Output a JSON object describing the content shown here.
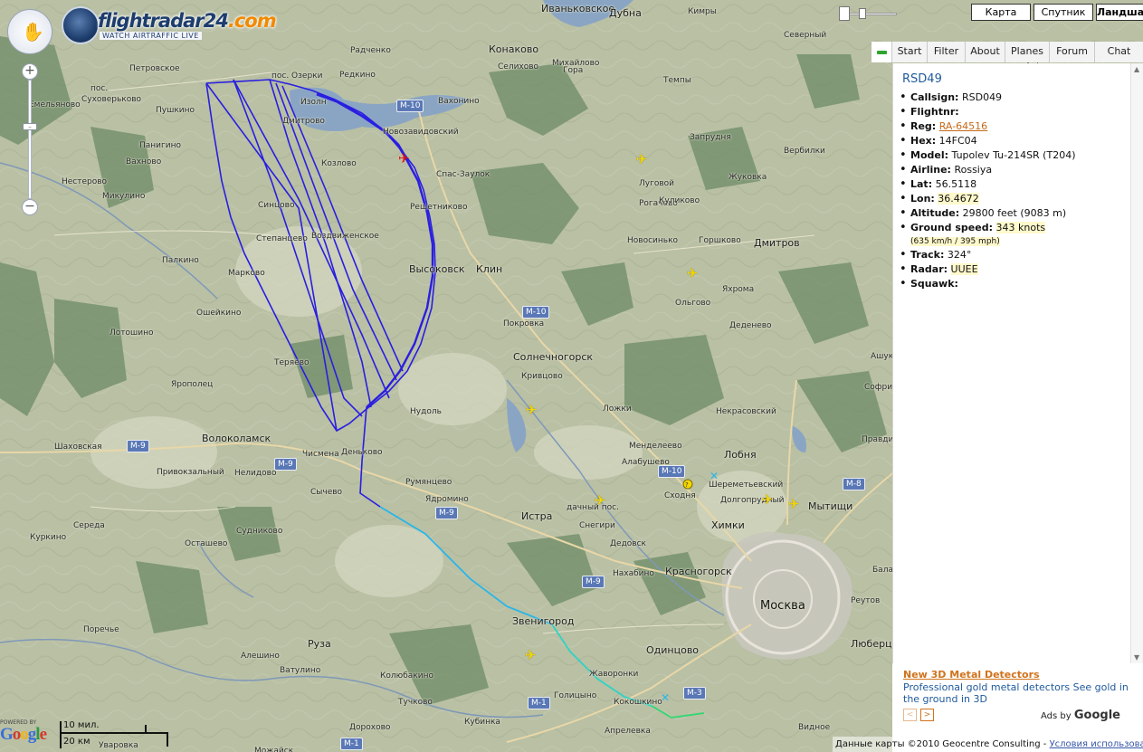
{
  "logo": {
    "name": "flightradar",
    "name_num": "24",
    "name_domain": ".com",
    "tagline": "WATCH AIRTRAFFIC LIVE"
  },
  "zoom": {
    "plus": "+",
    "minus": "−",
    "mid": "–"
  },
  "map_types": [
    "Карта",
    "Спутник",
    "Ландшафт"
  ],
  "tabs": [
    "Start",
    "Filter",
    "About",
    "Planes",
    "Forum",
    "Chat"
  ],
  "flight": {
    "title": "RSD49",
    "fields": [
      {
        "label": "Callsign:",
        "value": "RSD049"
      },
      {
        "label": "Flightnr:",
        "value": ""
      },
      {
        "label": "Reg:",
        "value": "RA-64516"
      },
      {
        "label": "Hex:",
        "value": "14FC04"
      },
      {
        "label": "Model:",
        "value": "Tupolev Tu-214SR (T204)"
      },
      {
        "label": "Airline:",
        "value": "Rossiya"
      },
      {
        "label": "Lat:",
        "value": "56.5118"
      },
      {
        "label": "Lon:",
        "value": "36.4672"
      },
      {
        "label": "Altitude:",
        "value": "29800 feet (9083 m)"
      },
      {
        "label": "Ground speed:",
        "value": "343 knots"
      },
      {
        "label": "",
        "value": "(635 km/h / 395 mph)"
      },
      {
        "label": "Track:",
        "value": "324°"
      },
      {
        "label": "Radar:",
        "value": "UUEE"
      },
      {
        "label": "Squawk:",
        "value": ""
      }
    ]
  },
  "ad": {
    "title": "New 3D Metal Detectors",
    "text": "Professional gold metal detectors See gold in the ground in 3D",
    "prev": "<",
    "next": ">",
    "ads_by": "Ads by ",
    "ads_brand": "Google"
  },
  "footer": {
    "powered": "POWERED BY",
    "google": "Google",
    "scale_mi": "10 мил.",
    "scale_km": "20 км",
    "copyright": "Данные карты ©2010 Geocentre Consulting - ",
    "terms": "Условия использования"
  },
  "places": [
    {
      "t": "Иваньковское",
      "c": "big"
    },
    {
      "t": "Дубна",
      "c": "big"
    },
    {
      "t": "Кимры"
    },
    {
      "t": "Кубринск"
    },
    {
      "t": "Конаково",
      "c": "big"
    },
    {
      "t": "Радченко"
    },
    {
      "t": "Михайлово"
    },
    {
      "t": "Гора"
    },
    {
      "t": "Селихово"
    },
    {
      "t": "Темпы"
    },
    {
      "t": "Северный"
    },
    {
      "t": "Петровское"
    },
    {
      "t": "пос."
    },
    {
      "t": "Суховерьково"
    },
    {
      "t": "Пушкино"
    },
    {
      "t": "Емельяново"
    },
    {
      "t": "пос. Озерки"
    },
    {
      "t": "Редкино"
    },
    {
      "t": "Изолн"
    },
    {
      "t": "Вахонино"
    },
    {
      "t": "Запрудня"
    },
    {
      "t": "Вербилки"
    },
    {
      "t": "Дмитрово"
    },
    {
      "t": "Новозавидовский"
    },
    {
      "t": "Панигино"
    },
    {
      "t": "Вахново"
    },
    {
      "t": "Козлово"
    },
    {
      "t": "Спас-Заулок"
    },
    {
      "t": "Луговой"
    },
    {
      "t": "Жуковка"
    },
    {
      "t": "Нестерово"
    },
    {
      "t": "Микулино"
    },
    {
      "t": "Синцово"
    },
    {
      "t": "Решетниково"
    },
    {
      "t": "Рогачево"
    },
    {
      "t": "Куликово"
    },
    {
      "t": "Степанцево"
    },
    {
      "t": "Воздвиженское"
    },
    {
      "t": "Новосинько"
    },
    {
      "t": "Горшково"
    },
    {
      "t": "Дмитров",
      "c": "big"
    },
    {
      "t": "Палкино"
    },
    {
      "t": "Марково"
    },
    {
      "t": "Высоковск",
      "c": "big"
    },
    {
      "t": "Клин",
      "c": "big"
    },
    {
      "t": "Ольгово"
    },
    {
      "t": "Яхрома"
    },
    {
      "t": "Ошейкино"
    },
    {
      "t": "Покровка"
    },
    {
      "t": "Деденево"
    },
    {
      "t": "Лотошино"
    },
    {
      "t": "Теряево"
    },
    {
      "t": "Солнечногорск",
      "c": "big"
    },
    {
      "t": "Ашукино"
    },
    {
      "t": "Ярополец"
    },
    {
      "t": "Кривцово"
    },
    {
      "t": "Софрино"
    },
    {
      "t": "Нудоль"
    },
    {
      "t": "Ложки"
    },
    {
      "t": "Некрасовский"
    },
    {
      "t": "Волоколамск",
      "c": "big"
    },
    {
      "t": "Шаховская"
    },
    {
      "t": "Чисмена"
    },
    {
      "t": "Деньково"
    },
    {
      "t": "Менделеево"
    },
    {
      "t": "Лобня",
      "c": "big"
    },
    {
      "t": "Правдинский"
    },
    {
      "t": "Алабушево"
    },
    {
      "t": "Шереметьевский"
    },
    {
      "t": "Привокзальный"
    },
    {
      "t": "Нелидово"
    },
    {
      "t": "Румянцево"
    },
    {
      "t": "Сычево"
    },
    {
      "t": "Сходня"
    },
    {
      "t": "Долгопрудный"
    },
    {
      "t": "Мытищи",
      "c": "big"
    },
    {
      "t": "Ядромино"
    },
    {
      "t": "Истра",
      "c": "big"
    },
    {
      "t": "Химки",
      "c": "big"
    },
    {
      "t": "Середа"
    },
    {
      "t": "Снегири"
    },
    {
      "t": "Дедовск"
    },
    {
      "t": "Куркино"
    },
    {
      "t": "Судниково"
    },
    {
      "t": "Осташево"
    },
    {
      "t": "Нахабино"
    },
    {
      "t": "Красногорск",
      "c": "big"
    },
    {
      "t": "Балашиха"
    },
    {
      "t": "Москва",
      "c": "city"
    },
    {
      "t": "Реутов"
    },
    {
      "t": "Звенигород",
      "c": "big"
    },
    {
      "t": "Поречье"
    },
    {
      "t": "Руза",
      "c": "big"
    },
    {
      "t": "Одинцово",
      "c": "big"
    },
    {
      "t": "Люберцы",
      "c": "big"
    },
    {
      "t": "Алешино"
    },
    {
      "t": "Ватулино"
    },
    {
      "t": "Колюбакино"
    },
    {
      "t": "Жаворонки"
    },
    {
      "t": "Голицыно"
    },
    {
      "t": "Кокошкино"
    },
    {
      "t": "Тучково"
    },
    {
      "t": "Кубинка"
    },
    {
      "t": "Апрелевка"
    },
    {
      "t": "Видное"
    },
    {
      "t": "Уваровка"
    },
    {
      "t": "Дорохово"
    },
    {
      "t": "Можайск"
    },
    {
      "t": "дачный пос."
    }
  ],
  "highways": [
    "M-10",
    "M-10",
    "M-9",
    "M-9",
    "M-9",
    "M-10",
    "M-8",
    "M-9",
    "M-1",
    "M-3",
    "M-1"
  ],
  "track_color": "#2a1ee0",
  "track_tail_color": "#29b6e8",
  "plane_color": "#f5d800"
}
